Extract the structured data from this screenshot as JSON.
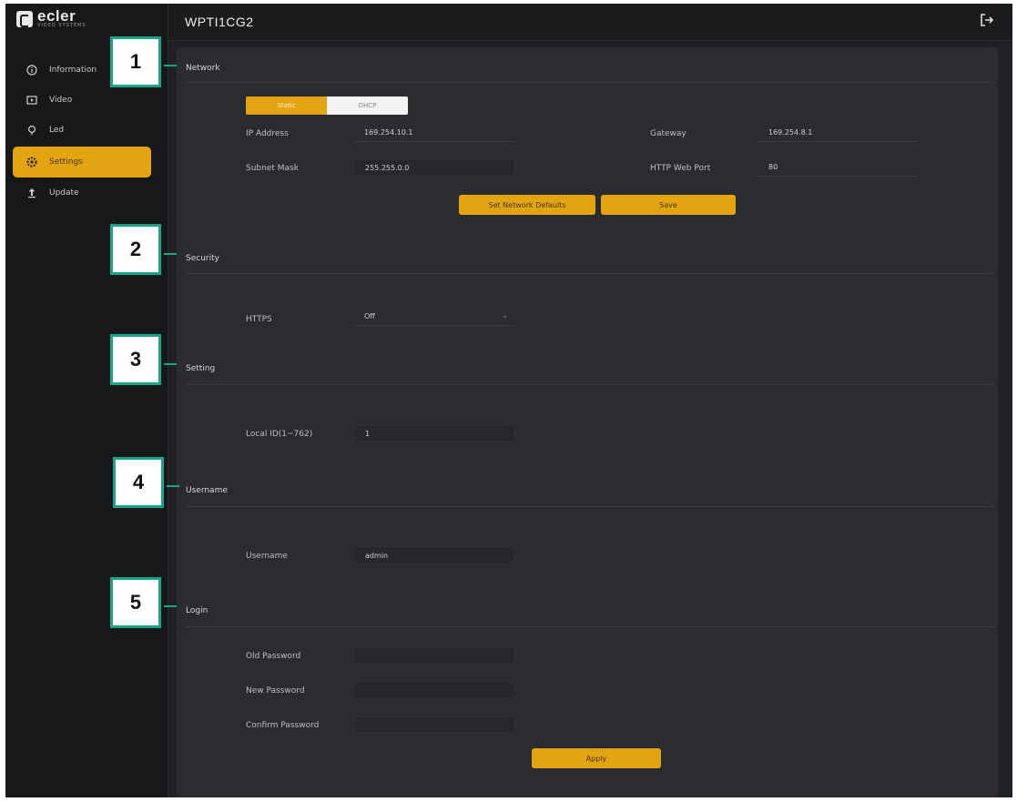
{
  "brand": {
    "name": "ecler",
    "sub": "VIDEO SYSTEMS"
  },
  "header": {
    "title": "WPTI1CG2",
    "logout_icon": "logout-icon"
  },
  "sidebar": {
    "items": [
      {
        "label": "Information",
        "icon": "info-icon",
        "active": false
      },
      {
        "label": "Video",
        "icon": "video-icon",
        "active": false
      },
      {
        "label": "Led",
        "icon": "bulb-icon",
        "active": false
      },
      {
        "label": "Settings",
        "icon": "gear-icon",
        "active": true
      },
      {
        "label": "Update",
        "icon": "upload-icon",
        "active": false
      }
    ]
  },
  "network": {
    "title": "Network",
    "mode": {
      "options": [
        "Static",
        "DHCP"
      ],
      "selected": "Static"
    },
    "ip_label": "IP Address",
    "ip_value": "169.254.10.1",
    "gateway_label": "Gateway",
    "gateway_value": "169.254.8.1",
    "subnet_label": "Subnet Mask",
    "subnet_value": "255.255.0.0",
    "port_label": "HTTP Web Port",
    "port_value": "80",
    "defaults_button": "Set Network Defaults",
    "save_button": "Save"
  },
  "security": {
    "title": "Security",
    "https_label": "HTTPS",
    "https_value": "Off"
  },
  "setting": {
    "title": "Setting",
    "local_id_label": "Local ID(1~762)",
    "local_id_value": "1"
  },
  "username": {
    "title": "Username",
    "username_label": "Username",
    "username_value": "admin"
  },
  "login": {
    "title": "Login",
    "old_label": "Old Password",
    "new_label": "New Password",
    "confirm_label": "Confirm Password",
    "apply_button": "Apply"
  },
  "callouts": [
    "1",
    "2",
    "3",
    "4",
    "5"
  ],
  "colors": {
    "accent": "#e3a412",
    "callout": "#1aa58a",
    "panel": "#2a2c30",
    "sidebar": "#16181a"
  }
}
